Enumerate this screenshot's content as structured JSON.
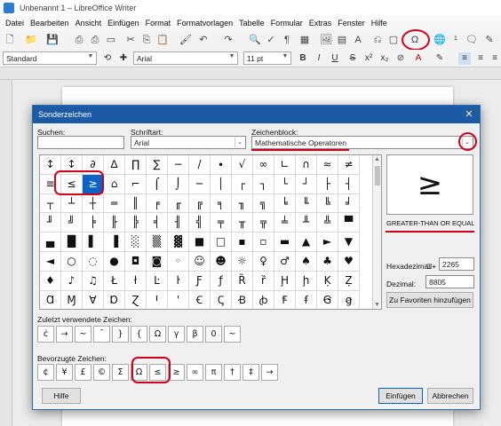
{
  "window": {
    "title": "Unbenannt 1 – LibreOffice Writer"
  },
  "menu": [
    "Datei",
    "Bearbeiten",
    "Ansicht",
    "Einfügen",
    "Format",
    "Formatvorlagen",
    "Tabelle",
    "Formular",
    "Extras",
    "Fenster",
    "Hilfe"
  ],
  "formatting": {
    "paragraph_style": "Standard",
    "font_name": "Arial",
    "font_size": "11 pt"
  },
  "dialog": {
    "title": "Sonderzeichen",
    "search_label": "Suchen:",
    "search_value": "",
    "font_label": "Schriftart:",
    "font_value": "Arial",
    "block_label": "Zeichenblock:",
    "block_value": "Mathematische Operatoren",
    "grid_rows": [
      [
        "↕",
        "↕",
        "∂",
        "∆",
        "∏",
        "∑",
        "−",
        "/",
        "∙",
        "√",
        "∞",
        "∟",
        "∩",
        "≈",
        "≠"
      ],
      [
        "≡",
        "≤",
        "≥",
        "⌂",
        "⌐",
        "⌠",
        "⌡",
        "─",
        "│",
        "┌",
        "┐",
        "└",
        "┘",
        "├",
        "┤"
      ],
      [
        "┬",
        "┴",
        "┼",
        "═",
        "║",
        "╒",
        "╓",
        "╔",
        "╕",
        "╖",
        "╗",
        "╘",
        "╙",
        "╚",
        "╛"
      ],
      [
        "╜",
        "╝",
        "╞",
        "╟",
        "╠",
        "╡",
        "╢",
        "╣",
        "╤",
        "╥",
        "╦",
        "╧",
        "╨",
        "╩",
        "▀"
      ],
      [
        "▄",
        "█",
        "▌",
        "▐",
        "░",
        "▒",
        "▓",
        "■",
        "□",
        "▪",
        "▫",
        "▬",
        "▲",
        "►",
        "▼"
      ],
      [
        "◄",
        "○",
        "◌",
        "●",
        "◘",
        "◙",
        "◦",
        "☺",
        "☻",
        "☼",
        "♀",
        "♂",
        "♠",
        "♣",
        "♥"
      ],
      [
        "♦",
        "♪",
        "♫",
        "Ł",
        "ł",
        "Ŀ",
        "ŀ",
        "Ƒ",
        "ƒ",
        "Ȑ",
        "ȑ",
        "Ḩ",
        "ḩ",
        "Ḳ",
        "Ẓ"
      ],
      [
        "Ɑ",
        "Ɱ",
        "Ɐ",
        "Ɒ",
        "Ɀ",
        "Ꞌ",
        "ꞌ",
        "Ꞓ",
        "Ꞔ",
        "Ꞗ",
        "ꞗ",
        "Ꞙ",
        "ꞙ",
        "Ꞡ",
        "ꞡ"
      ]
    ],
    "selected_char": "≥",
    "char_name": "GREATER-THAN OR EQUAL TO",
    "hex_label": "Hexadezimal:",
    "hex_prefix": "U+",
    "hex_value": "2265",
    "dec_label": "Dezimal:",
    "dec_value": "8805",
    "fav_button": "Zu Favoriten hinzufügen",
    "recent_label": "Zuletzt verwendete Zeichen:",
    "recent_chars": [
      "ċ",
      "→",
      "~",
      "¯",
      "}",
      "{",
      "Ω",
      "γ",
      "β",
      "0",
      "~"
    ],
    "favorites_label": "Bevorzugte Zeichen:",
    "favorite_chars": [
      "¢",
      "¥",
      "£",
      "©",
      "Σ",
      "Ω",
      "≤",
      "≥",
      "∞",
      "π",
      "†",
      "‡",
      "→"
    ],
    "help_button": "Hilfe",
    "insert_button": "Einfügen",
    "cancel_button": "Abbrechen"
  },
  "accent_colors": {
    "dialog_title": "#1c5aa6",
    "selection": "#0a64c8",
    "highlight": "#d0021b"
  }
}
